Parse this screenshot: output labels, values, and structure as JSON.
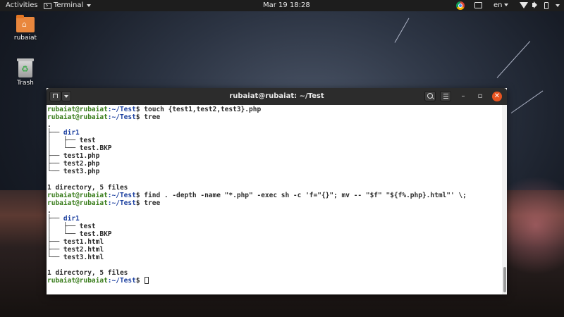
{
  "topbar": {
    "activities": "Activities",
    "app_menu": "Terminal",
    "clock": "Mar 19  18:28",
    "lang": "en"
  },
  "desktop": {
    "icons": [
      {
        "label": "rubaiat",
        "icon": "home-folder-icon"
      },
      {
        "label": "Trash",
        "icon": "trash-icon"
      }
    ]
  },
  "window": {
    "title": "rubaiat@rubaiat: ~/Test"
  },
  "terminal": {
    "user": "rubaiat@rubaiat",
    "path": ":~/Test",
    "dollar": "$",
    "lines": [
      {
        "kind": "prompt",
        "cmd": " touch {test1,test2,test3}.php"
      },
      {
        "kind": "prompt",
        "cmd": " tree"
      },
      {
        "kind": "text",
        "text": "."
      },
      {
        "kind": "dir",
        "prefix": "├── ",
        "text": "dir1"
      },
      {
        "kind": "text",
        "text": "│   ├── test"
      },
      {
        "kind": "text",
        "text": "│   └── test.BKP"
      },
      {
        "kind": "text",
        "text": "├── test1.php"
      },
      {
        "kind": "text",
        "text": "├── test2.php"
      },
      {
        "kind": "text",
        "text": "└── test3.php"
      },
      {
        "kind": "text",
        "text": ""
      },
      {
        "kind": "text",
        "text": "1 directory, 5 files"
      },
      {
        "kind": "prompt",
        "cmd": " find . -depth -name \"*.php\" -exec sh -c 'f=\"{}\"; mv -- \"$f\" \"${f%.php}.html\"' \\;"
      },
      {
        "kind": "prompt",
        "cmd": " tree"
      },
      {
        "kind": "text",
        "text": "."
      },
      {
        "kind": "dir",
        "prefix": "├── ",
        "text": "dir1"
      },
      {
        "kind": "text",
        "text": "│   ├── test"
      },
      {
        "kind": "text",
        "text": "│   └── test.BKP"
      },
      {
        "kind": "text",
        "text": "├── test1.html"
      },
      {
        "kind": "text",
        "text": "├── test2.html"
      },
      {
        "kind": "text",
        "text": "└── test3.html"
      },
      {
        "kind": "text",
        "text": ""
      },
      {
        "kind": "text",
        "text": "1 directory, 5 files"
      },
      {
        "kind": "prompt",
        "cmd": " ",
        "cursor": true
      }
    ]
  }
}
